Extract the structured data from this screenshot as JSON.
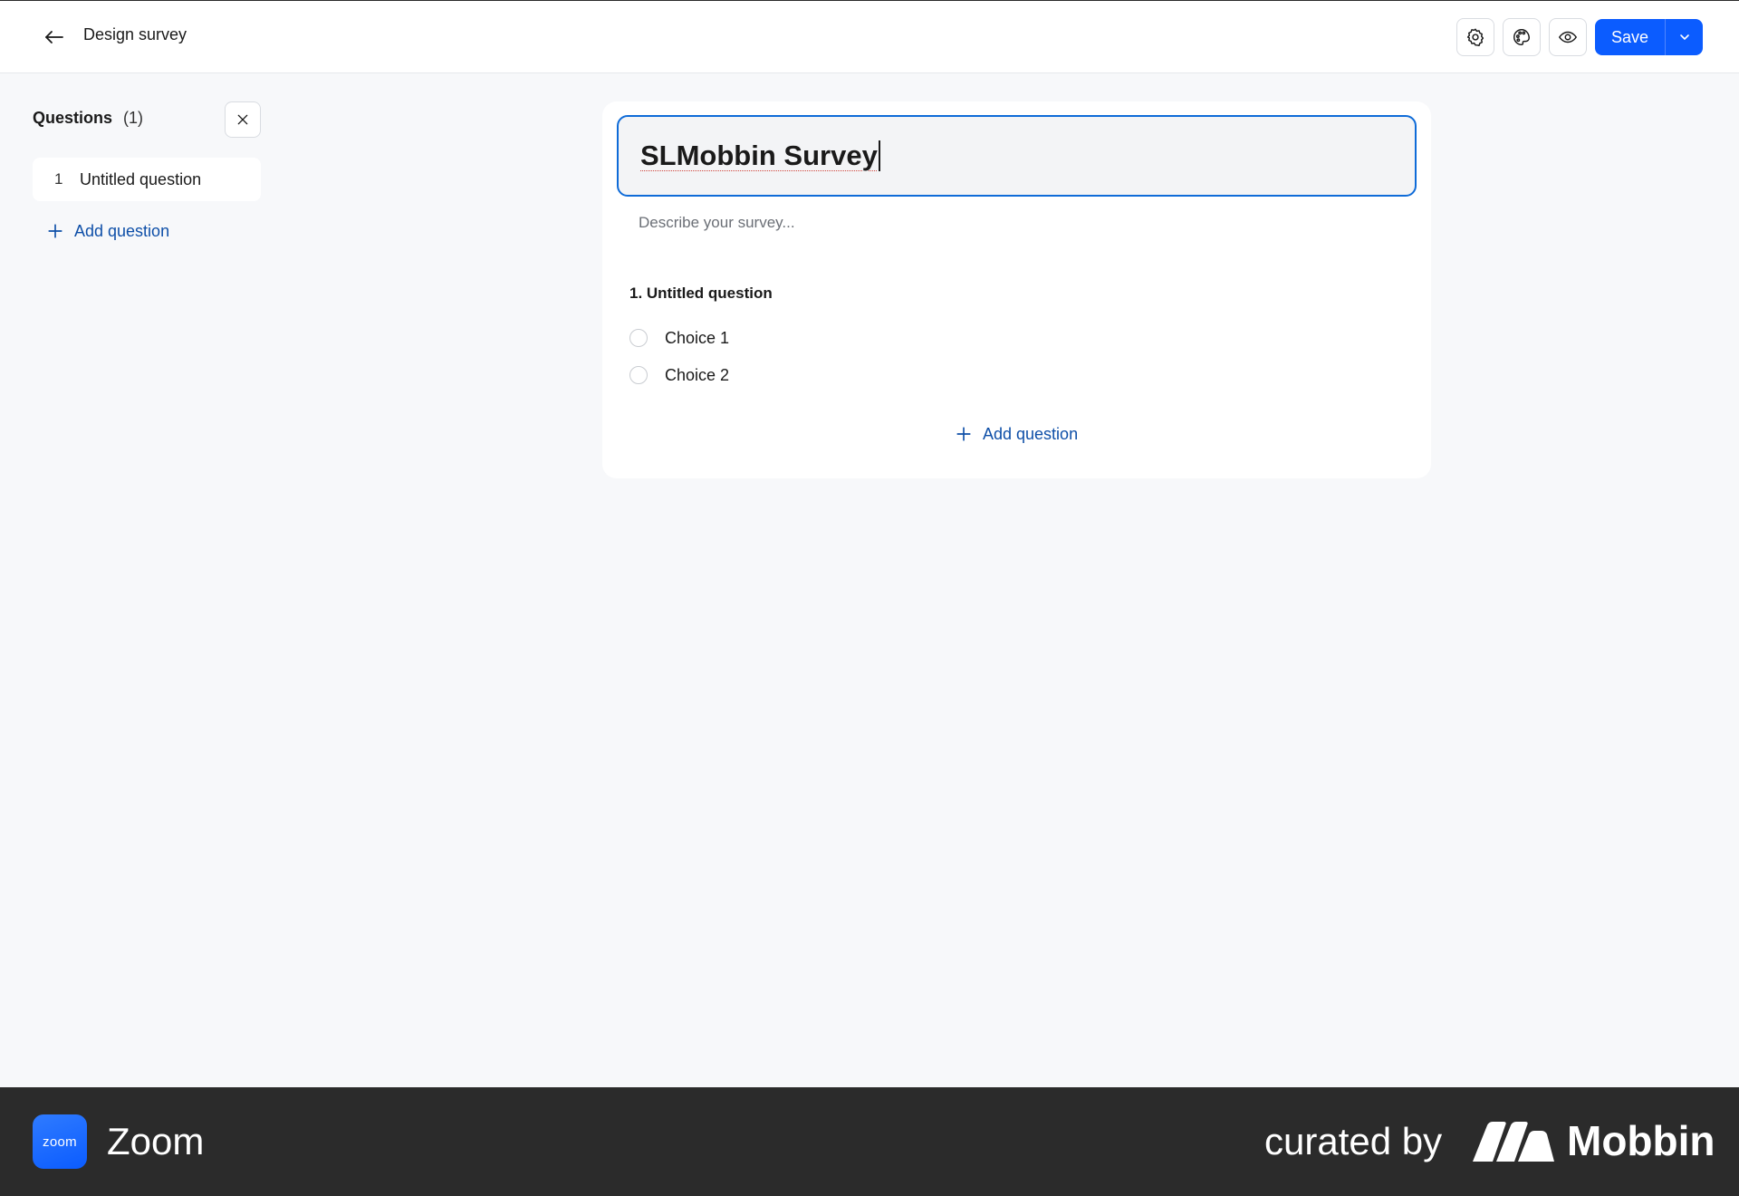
{
  "header": {
    "back_icon": "arrow-left-icon",
    "title": "Design survey",
    "settings_icon": "gear-icon",
    "theme_icon": "palette-icon",
    "preview_icon": "eye-icon",
    "save_label": "Save",
    "save_menu_icon": "chevron-down-icon",
    "accent_color": "#0b5cff"
  },
  "sidebar": {
    "heading": "Questions",
    "count": "(1)",
    "close_icon": "close-icon",
    "items": [
      {
        "number": "1",
        "label": "Untitled question"
      }
    ],
    "add_label": "Add question"
  },
  "survey": {
    "title": "SLMobbin Survey",
    "description_placeholder": "Describe your survey...",
    "questions": [
      {
        "title": "1.  Untitled question",
        "choices": [
          "Choice 1",
          "Choice 2"
        ]
      }
    ],
    "add_label": "Add question"
  },
  "footer": {
    "app_logo_text": "zoom",
    "app_name": "Zoom",
    "curated_by": "curated by",
    "brand": "Mobbin"
  }
}
